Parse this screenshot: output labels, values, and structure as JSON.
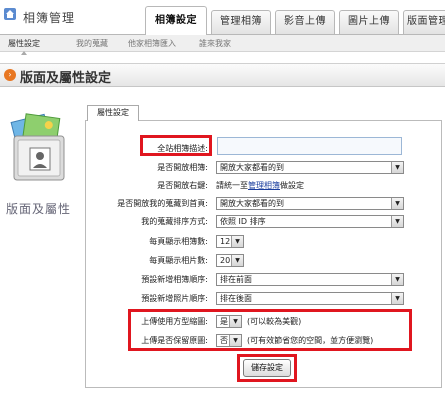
{
  "header": {
    "title": "相簿管理",
    "tabs": [
      {
        "label": "相簿設定",
        "active": true
      },
      {
        "label": "管理相簿",
        "active": false
      },
      {
        "label": "影音上傳",
        "active": false
      },
      {
        "label": "圖片上傳",
        "active": false
      },
      {
        "label": "版面管理",
        "active": false
      }
    ]
  },
  "subnav": [
    "屬性設定",
    "我的蒐藏",
    "他家相簿匯入",
    "誰來我家"
  ],
  "section": {
    "title": "版面及屬性設定",
    "icon": "chevron-right-icon"
  },
  "illustration": {
    "label": "版面及屬性"
  },
  "panel": {
    "tab": "屬性設定",
    "rows": {
      "description": {
        "label": "全站相簿描述:",
        "value": ""
      },
      "open_album": {
        "label": "是否開放相簿:",
        "value": "開放大家都看的到"
      },
      "open_rightclick": {
        "label": "是否開放右鍵:",
        "prefix": "請統一至",
        "link": "管理相簿",
        "suffix": "做設定"
      },
      "open_favorites": {
        "label": "是否開放我的蒐藏到首頁:",
        "value": "開放大家都看的到"
      },
      "fav_sort": {
        "label": "我的蒐藏排序方式:",
        "value": "依照 ID 排序"
      },
      "albums_per_page": {
        "label": "每頁顯示相簿數:",
        "value": "12"
      },
      "photos_per_page": {
        "label": "每頁顯示相片數:",
        "value": "20"
      },
      "new_album_order": {
        "label": "預設新增相簿順序:",
        "value": "排在前面"
      },
      "new_photo_order": {
        "label": "預設新增照片順序:",
        "value": "排在後面"
      },
      "use_square_thumb": {
        "label": "上傳使用方型縮圖:",
        "value": "是",
        "note": "(可以較為美觀)"
      },
      "keep_original": {
        "label": "上傳是否保留原圖:",
        "value": "否",
        "note": "(可有效節省您的空間，並方便瀏覽)"
      }
    },
    "save_label": "儲存設定"
  },
  "colors": {
    "highlight": "#e0161f",
    "accent": "#e87722",
    "link": "#1a3d9e"
  }
}
